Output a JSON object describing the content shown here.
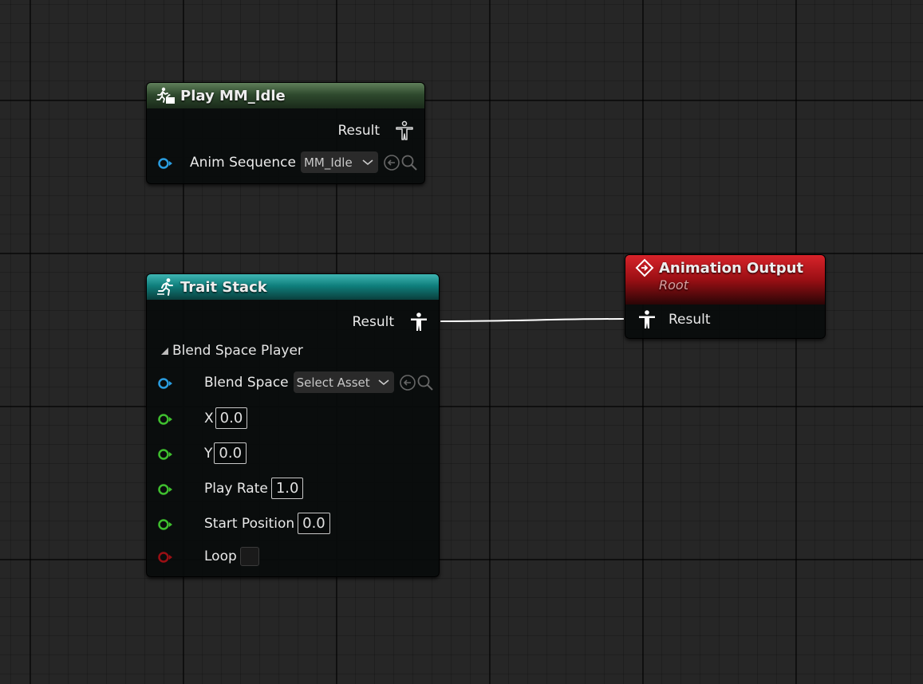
{
  "colors": {
    "background": "#262626",
    "wire": "#ffffff",
    "pin_blue": "#2a9de0",
    "pin_green": "#3fbf2f",
    "pin_red": "#9a0f14"
  },
  "nodes": {
    "play": {
      "title": "Play MM_Idle",
      "header_icon": "play-sequence-icon",
      "output_label": "Result",
      "output_icon": "pose-outline-icon",
      "anim_sequence_label": "Anim Sequence",
      "anim_sequence_value": "MM_Idle"
    },
    "trait": {
      "title": "Trait Stack",
      "header_icon": "running-person-icon",
      "output_label": "Result",
      "output_icon": "pose-icon",
      "section_label": "Blend Space Player",
      "blend_space_label": "Blend Space",
      "blend_space_value": "Select Asset",
      "x_label": "X",
      "x_value": "0.0",
      "y_label": "Y",
      "y_value": "0.0",
      "play_rate_label": "Play Rate",
      "play_rate_value": "1.0",
      "start_position_label": "Start Position",
      "start_position_value": "0.0",
      "loop_label": "Loop",
      "loop_checked": false
    },
    "output": {
      "title": "Animation Output",
      "subtitle": "Root",
      "header_icon": "diamond-entry-icon",
      "input_label": "Result",
      "input_icon": "pose-icon"
    }
  }
}
